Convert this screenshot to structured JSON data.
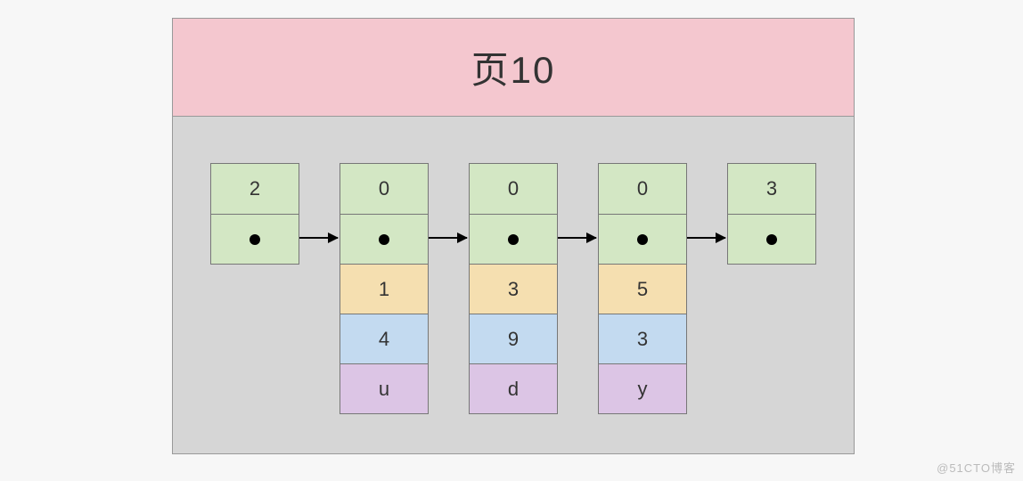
{
  "header": {
    "title": "页10"
  },
  "nodes": [
    {
      "top": "2",
      "extra": null
    },
    {
      "top": "0",
      "extra": {
        "a": "1",
        "b": "4",
        "c": "u"
      }
    },
    {
      "top": "0",
      "extra": {
        "a": "3",
        "b": "9",
        "c": "d"
      }
    },
    {
      "top": "0",
      "extra": {
        "a": "5",
        "b": "3",
        "c": "y"
      }
    },
    {
      "top": "3",
      "extra": null
    }
  ],
  "watermark": "@51CTO博客"
}
